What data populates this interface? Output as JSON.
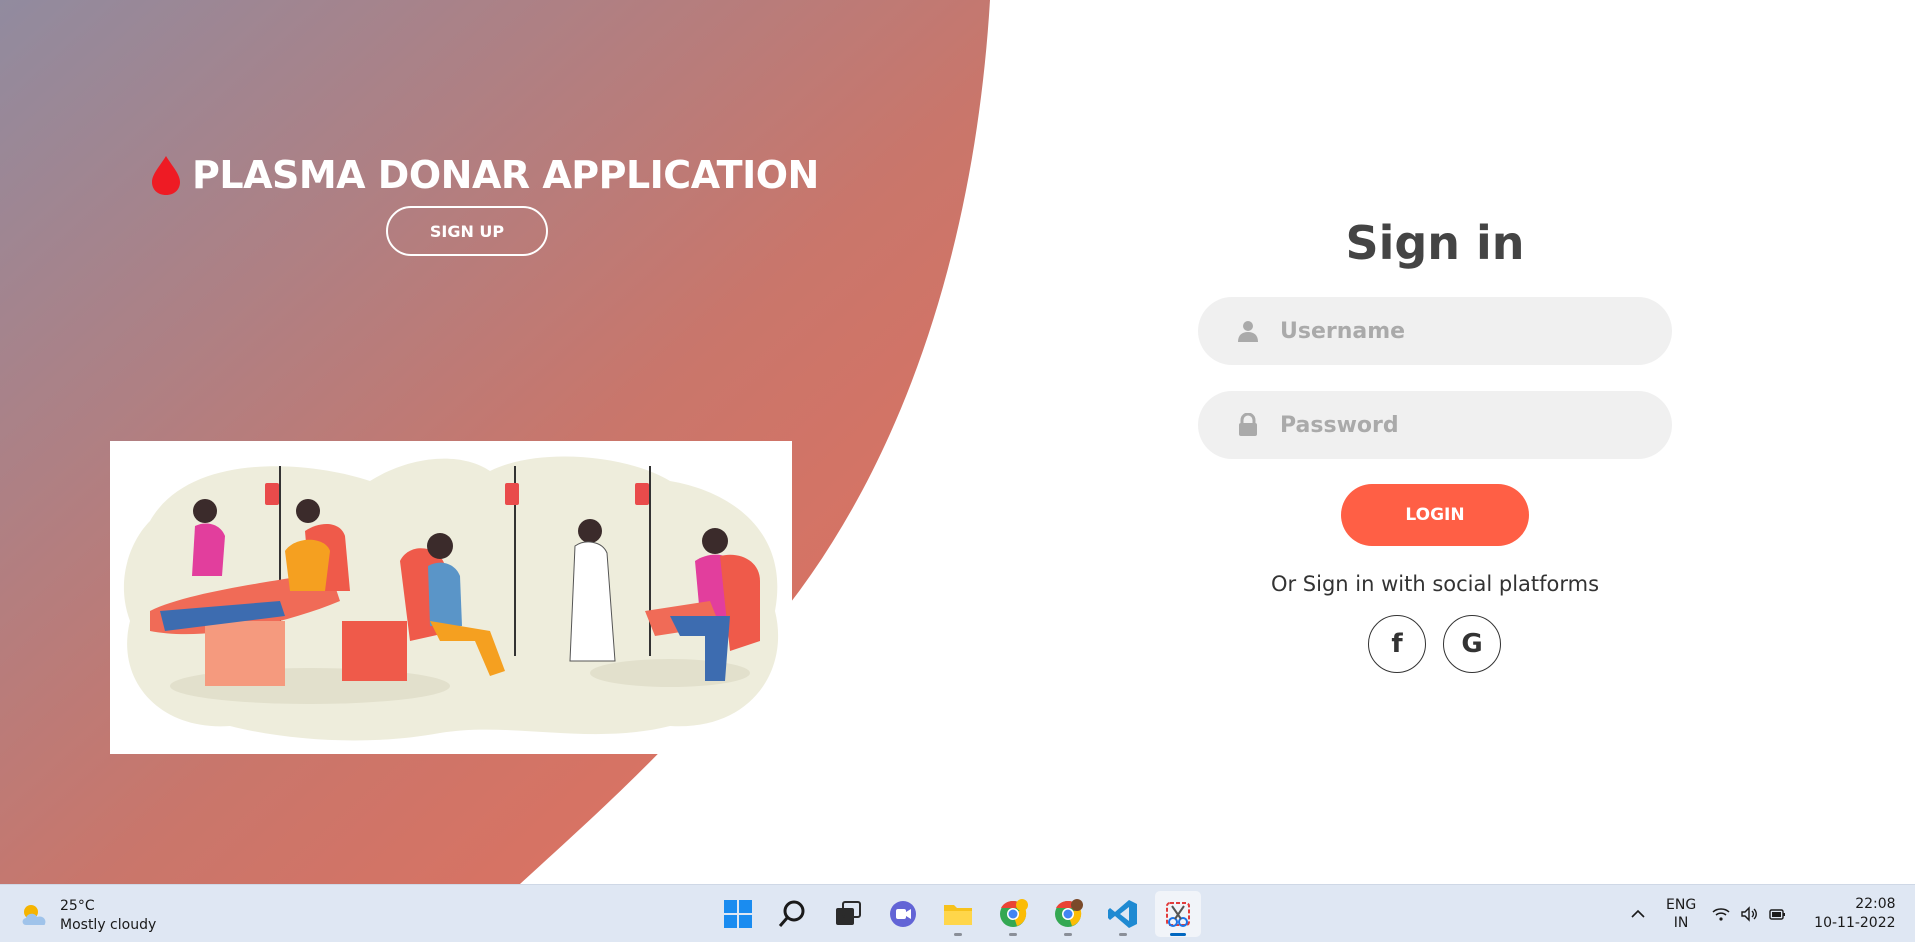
{
  "app": {
    "title": "PLASMA DONAR APPLICATION",
    "signup_label": "SIGN UP",
    "accent_color": "#ff5f45",
    "panel_gradient_start": "#918b9f",
    "panel_gradient_end": "#e76f5b"
  },
  "signin": {
    "title": "Sign in",
    "username_placeholder": "Username",
    "password_placeholder": "Password",
    "login_label": "LOGIN",
    "social_text": "Or Sign in with social platforms",
    "facebook_glyph": "f",
    "google_glyph": "G"
  },
  "taskbar": {
    "weather_temp": "25°C",
    "weather_desc": "Mostly cloudy",
    "apps": [
      "start-icon",
      "search-icon",
      "task-view-icon",
      "chat-icon",
      "file-explorer-icon",
      "chrome-profile-icon",
      "chrome-icon",
      "vscode-icon",
      "snipping-tool-icon"
    ],
    "lang_line1": "ENG",
    "lang_line2": "IN",
    "time": "22:08",
    "date": "10-11-2022"
  }
}
